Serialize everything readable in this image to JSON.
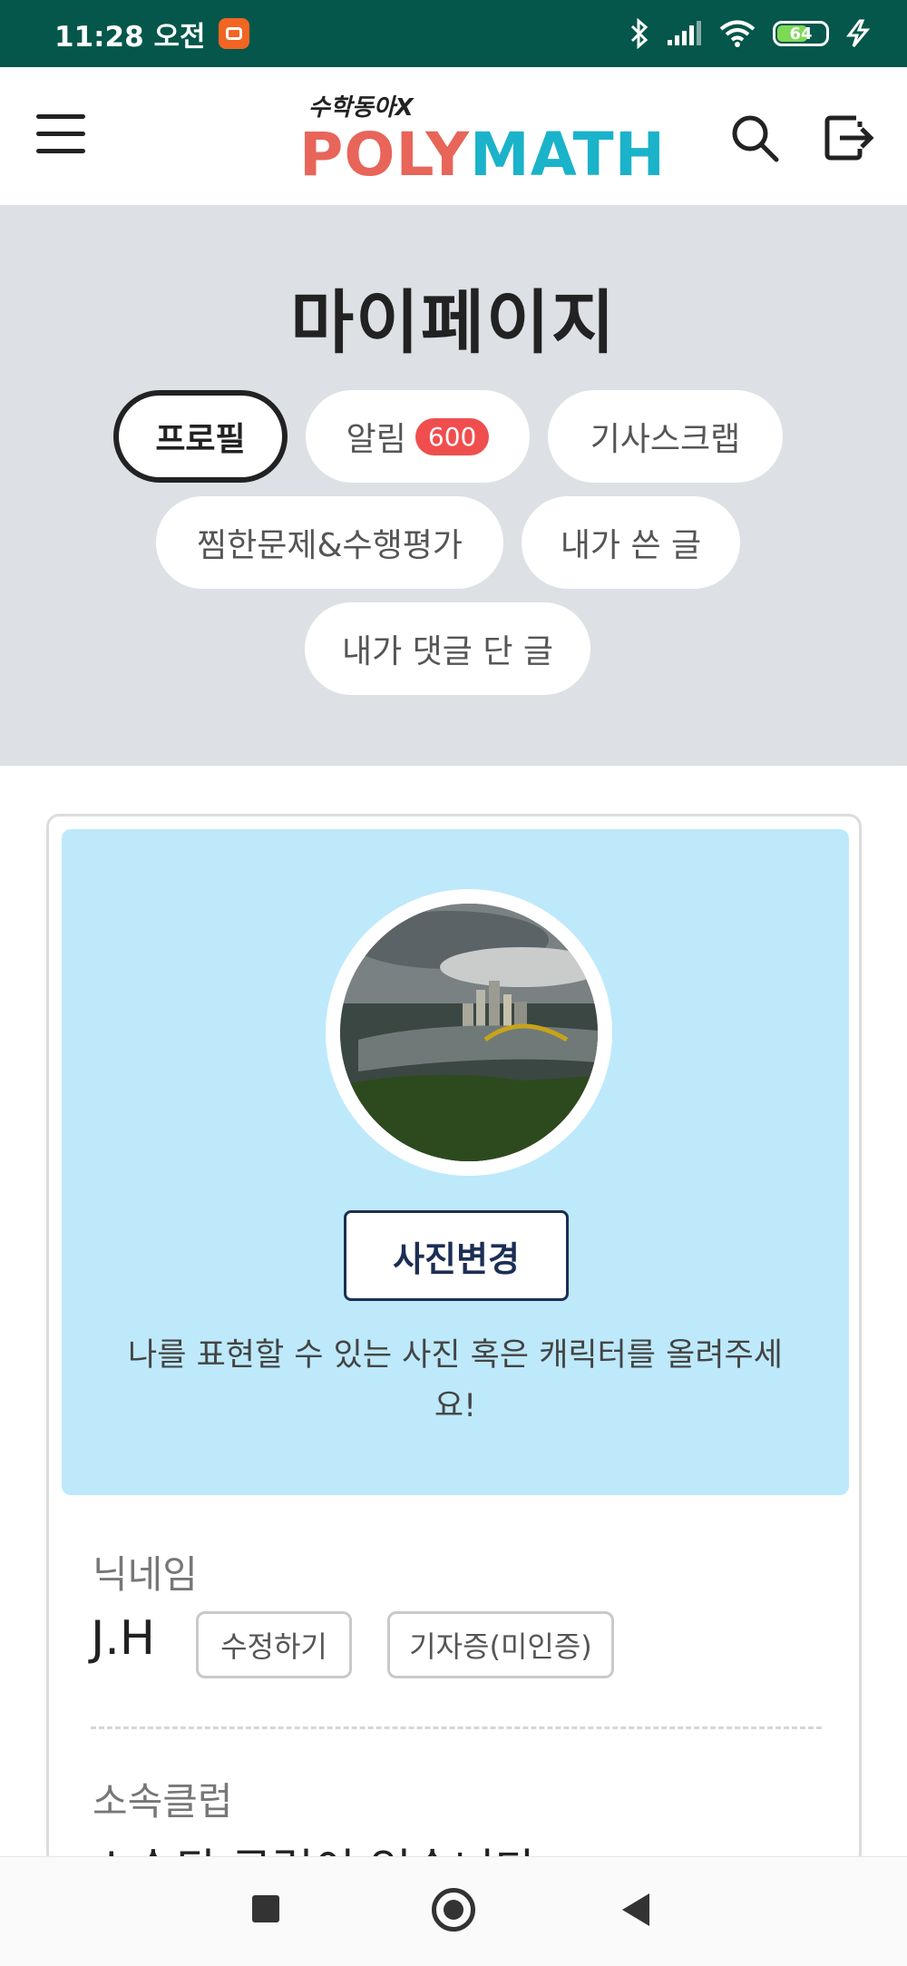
{
  "status_bar": {
    "time": "11:28 오전",
    "battery": "64"
  },
  "header": {
    "logo_sub": "수학동아X",
    "logo_poly": "POLY",
    "logo_math": "MATH"
  },
  "page": {
    "title": "마이페이지"
  },
  "tabs": [
    {
      "label": "프로필",
      "active": true
    },
    {
      "label": "알림",
      "badge": "600"
    },
    {
      "label": "기사스크랩"
    },
    {
      "label": "찜한문제&수행평가"
    },
    {
      "label": "내가 쓴 글"
    },
    {
      "label": "내가 댓글 단 글"
    }
  ],
  "profile": {
    "change_photo_label": "사진변경",
    "photo_hint": "나를 표현할 수 있는 사진 혹은 캐릭터를 올려주세요!",
    "nickname_label": "닉네임",
    "nickname_value": "J.H",
    "edit_label": "수정하기",
    "press_card_label": "기자증(미인증)",
    "club_label": "소속클럽",
    "club_value": "소속된 클럽이 없습니다"
  },
  "colors": {
    "status_bar": "#04574a",
    "hero_bg": "#dde0e5",
    "photo_panel": "#bde9fb",
    "badge": "#f04e4e",
    "logo_poly": "#e8655a",
    "logo_math": "#1ab3c9"
  }
}
